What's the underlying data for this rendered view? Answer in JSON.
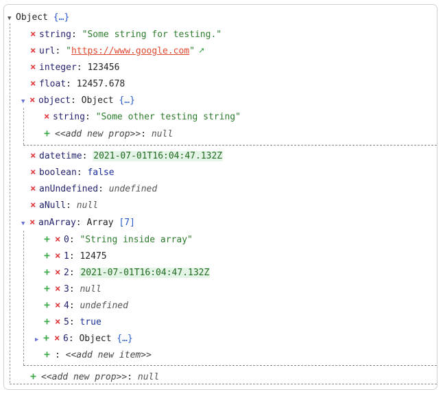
{
  "root": {
    "label": "Object",
    "summary": "{…}"
  },
  "props": {
    "string": {
      "key": "string",
      "value": "\"Some string for testing.\""
    },
    "url": {
      "key": "url",
      "quote_open": "\"",
      "value": "https://www.google.com",
      "quote_close": "\""
    },
    "integer": {
      "key": "integer",
      "value": "123456"
    },
    "float": {
      "key": "float",
      "value": "12457.678"
    },
    "object": {
      "key": "object",
      "type": "Object",
      "summary": "{…}",
      "child_key": "string",
      "child_value": "\"Some other testing string\""
    },
    "datetime": {
      "key": "datetime",
      "value": "2021-07-01T16:04:47.132Z"
    },
    "boolean": {
      "key": "boolean",
      "value": "false"
    },
    "anUndefined": {
      "key": "anUndefined",
      "value": "undefined"
    },
    "aNull": {
      "key": "aNull",
      "value": "null"
    },
    "anArray": {
      "key": "anArray",
      "type": "Array",
      "summary": "[7]"
    }
  },
  "array_items": [
    {
      "index": "0",
      "value": "\"String inside array\""
    },
    {
      "index": "1",
      "value": "12475"
    },
    {
      "index": "2",
      "value": "2021-07-01T16:04:47.132Z"
    },
    {
      "index": "3",
      "value": "null"
    },
    {
      "index": "4",
      "value": "undefined"
    },
    {
      "index": "5",
      "value": "true"
    },
    {
      "index": "6",
      "type": "Object",
      "summary": "{…}"
    }
  ],
  "labels": {
    "add_prop": "<<add new prop>>",
    "add_item": "<<add new item>>",
    "null": "null"
  },
  "icons": {
    "delete": "delete-icon",
    "add": "add-icon",
    "expand": "expand-triangle-icon",
    "open_link": "external-link-icon"
  }
}
